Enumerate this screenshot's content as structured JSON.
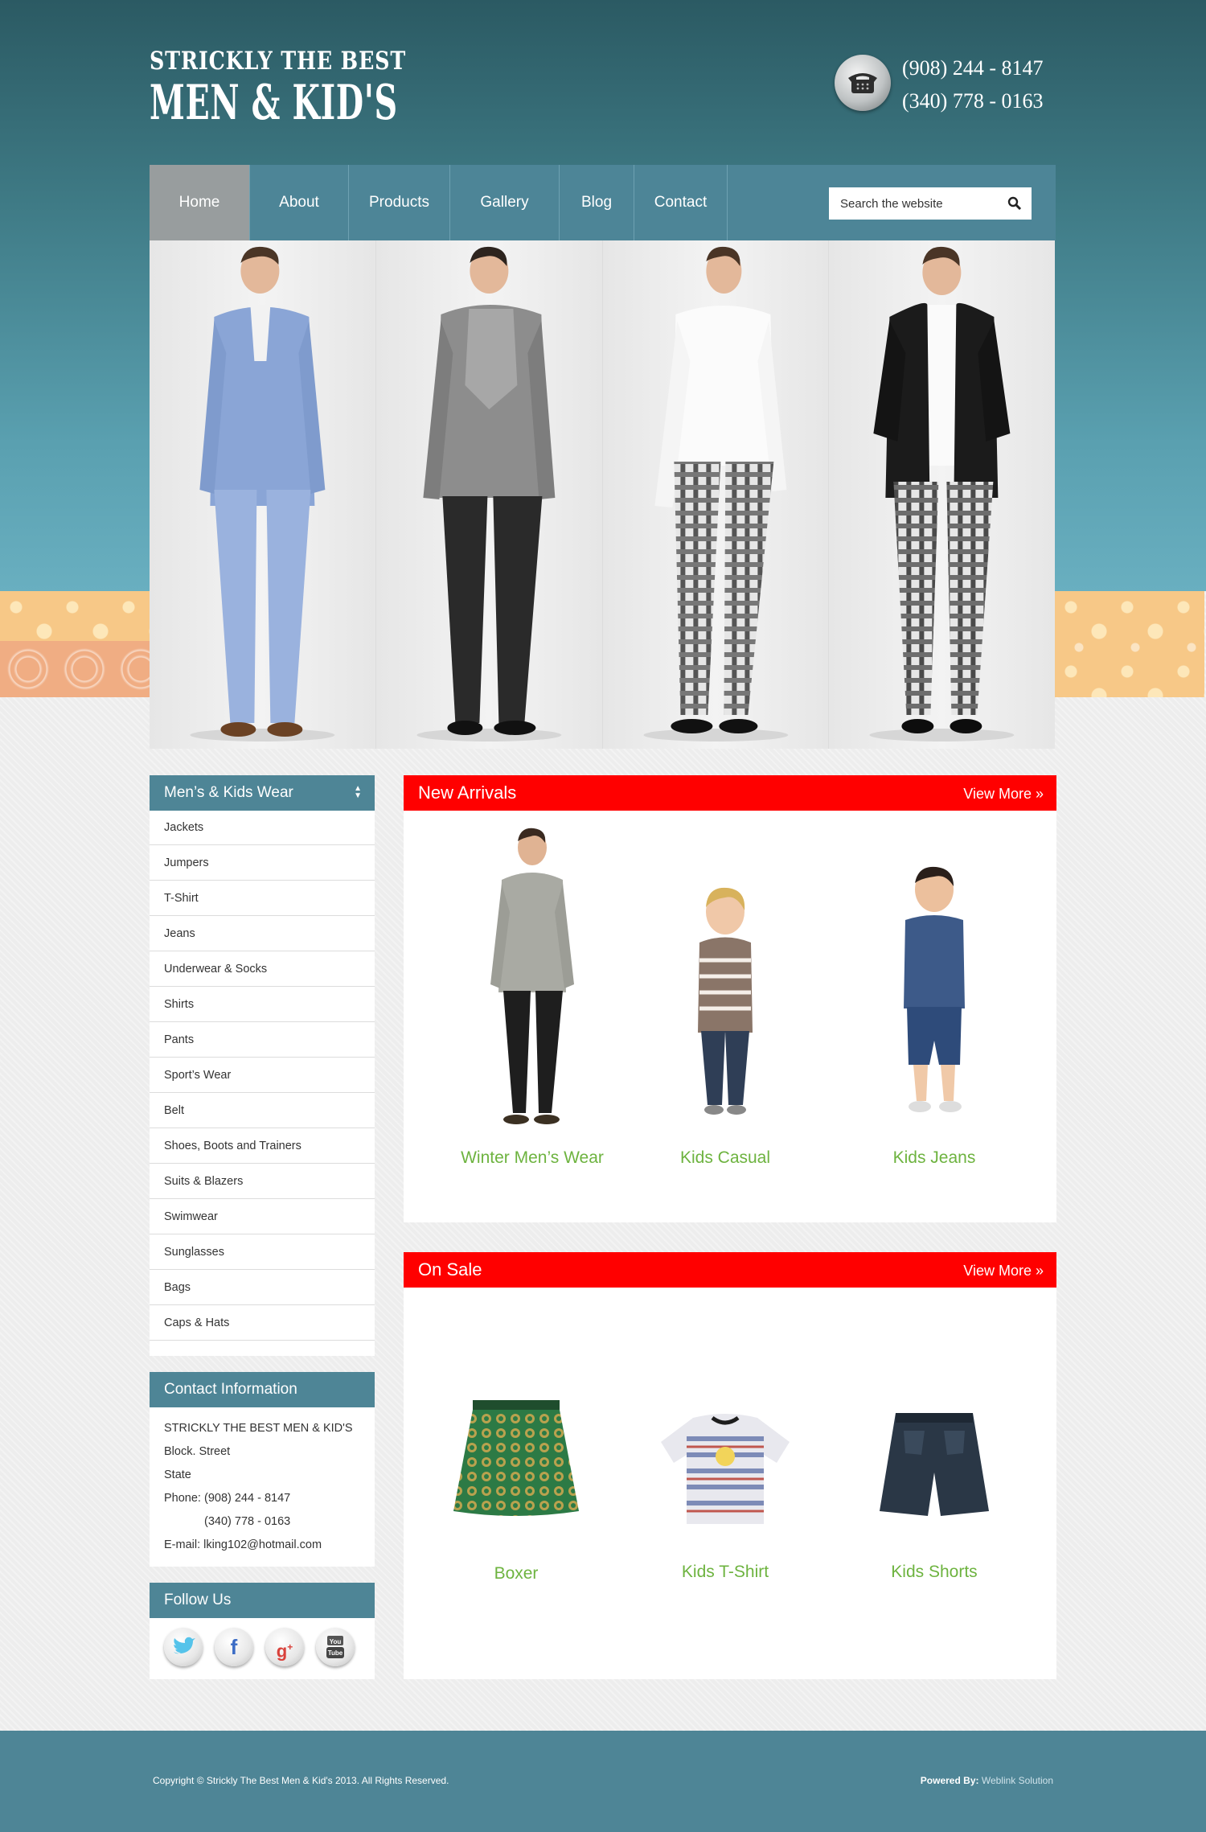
{
  "header": {
    "logo_line1": "STRICKLY THE BEST",
    "logo_line2": "MEN & KID'S",
    "phone1": "(908) 244 - 8147",
    "phone2": "(340) 778 - 0163"
  },
  "nav": {
    "items": [
      "Home",
      "About",
      "Products",
      "Gallery",
      "Blog",
      "Contact"
    ],
    "active": "Home",
    "search_placeholder": "Search the website"
  },
  "sidebar": {
    "categories_title": "Men’s & Kids Wear",
    "categories": [
      "Jackets",
      "Jumpers",
      "T-Shirt",
      "Jeans",
      "Underwear & Socks",
      "Shirts",
      "Pants",
      "Sport’s Wear",
      "Belt",
      "Shoes, Boots and Trainers",
      "Suits & Blazers",
      "Swimwear",
      "Sunglasses",
      "Bags",
      "Caps & Hats"
    ],
    "contact_title": "Contact Information",
    "contact": {
      "company": "STRICKLY THE BEST MEN & KID'S",
      "street": "Block. Street",
      "state": "State",
      "phone_line1": "Phone: (908) 244 - 8147",
      "phone_line2": "(340) 778 - 0163",
      "email": "E-mail: lking102@hotmail.com"
    },
    "follow_title": "Follow Us",
    "social_icons": [
      "twitter-icon",
      "facebook-icon",
      "google-plus-icon",
      "youtube-icon"
    ]
  },
  "new_arrivals": {
    "title": "New Arrivals",
    "view_more": "View More »",
    "products": [
      "Winter Men’s Wear",
      "Kids Casual",
      "Kids Jeans"
    ]
  },
  "on_sale": {
    "title": "On Sale",
    "view_more": "View More »",
    "products": [
      "Boxer",
      "Kids T-Shirt",
      "Kids Shorts"
    ]
  },
  "footer": {
    "copyright": "Copyright © Strickly The Best Men & Kid's 2013. All Rights Reserved.",
    "powered_label": "Powered By:",
    "powered_name": "Weblink Solution"
  },
  "colors": {
    "nav": "#4d8597",
    "accent_red": "#ff0000",
    "product_green": "#6db33f"
  }
}
